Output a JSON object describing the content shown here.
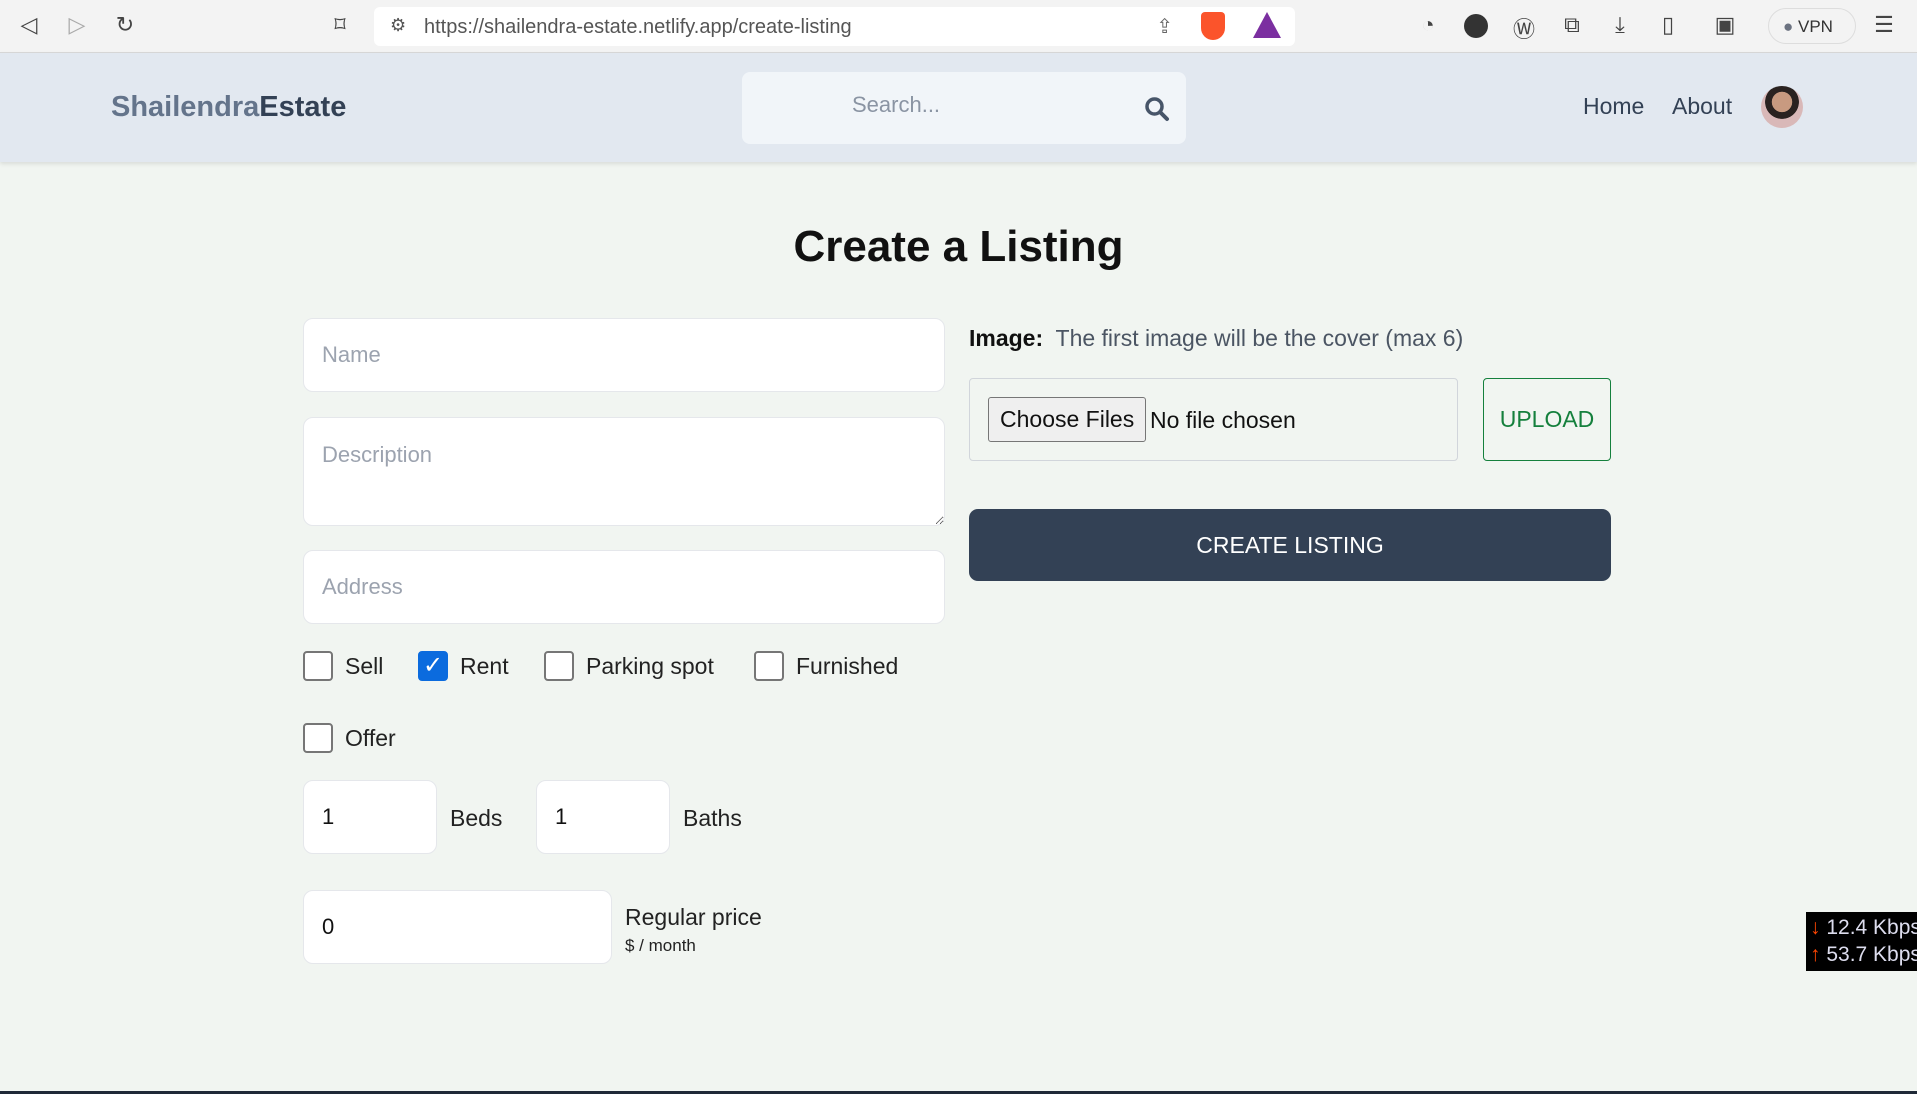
{
  "browser": {
    "url": "https://shailendra-estate.netlify.app/create-listing",
    "vpn_label": "VPN"
  },
  "header": {
    "logo_part1": "Shailendra",
    "logo_part2": "Estate",
    "search_placeholder": "Search...",
    "nav": [
      "Home",
      "About"
    ]
  },
  "page": {
    "title": "Create a Listing"
  },
  "form": {
    "name_placeholder": "Name",
    "description_placeholder": "Description",
    "address_placeholder": "Address",
    "checkboxes": [
      {
        "label": "Sell",
        "checked": false
      },
      {
        "label": "Rent",
        "checked": true
      },
      {
        "label": "Parking spot",
        "checked": false
      },
      {
        "label": "Furnished",
        "checked": false
      },
      {
        "label": "Offer",
        "checked": false
      }
    ],
    "beds": "1",
    "beds_label": "Beds",
    "baths": "1",
    "baths_label": "Baths",
    "price": "0",
    "price_label": "Regular price",
    "price_unit": "$ / month",
    "image_label": "Image:",
    "image_hint": "The first image will be the cover (max 6)",
    "choose_files": "Choose Files",
    "no_file": "No file chosen",
    "upload": "UPLOAD",
    "submit": "CREATE LISTING"
  },
  "net_widget": {
    "down": "12.4 Kbps",
    "up": "53.7 Kbps"
  },
  "colors": {
    "header_bg": "#e2e8f0",
    "button_bg": "#334155",
    "upload_green": "#15803d",
    "checkbox_blue": "#0b6bde"
  }
}
